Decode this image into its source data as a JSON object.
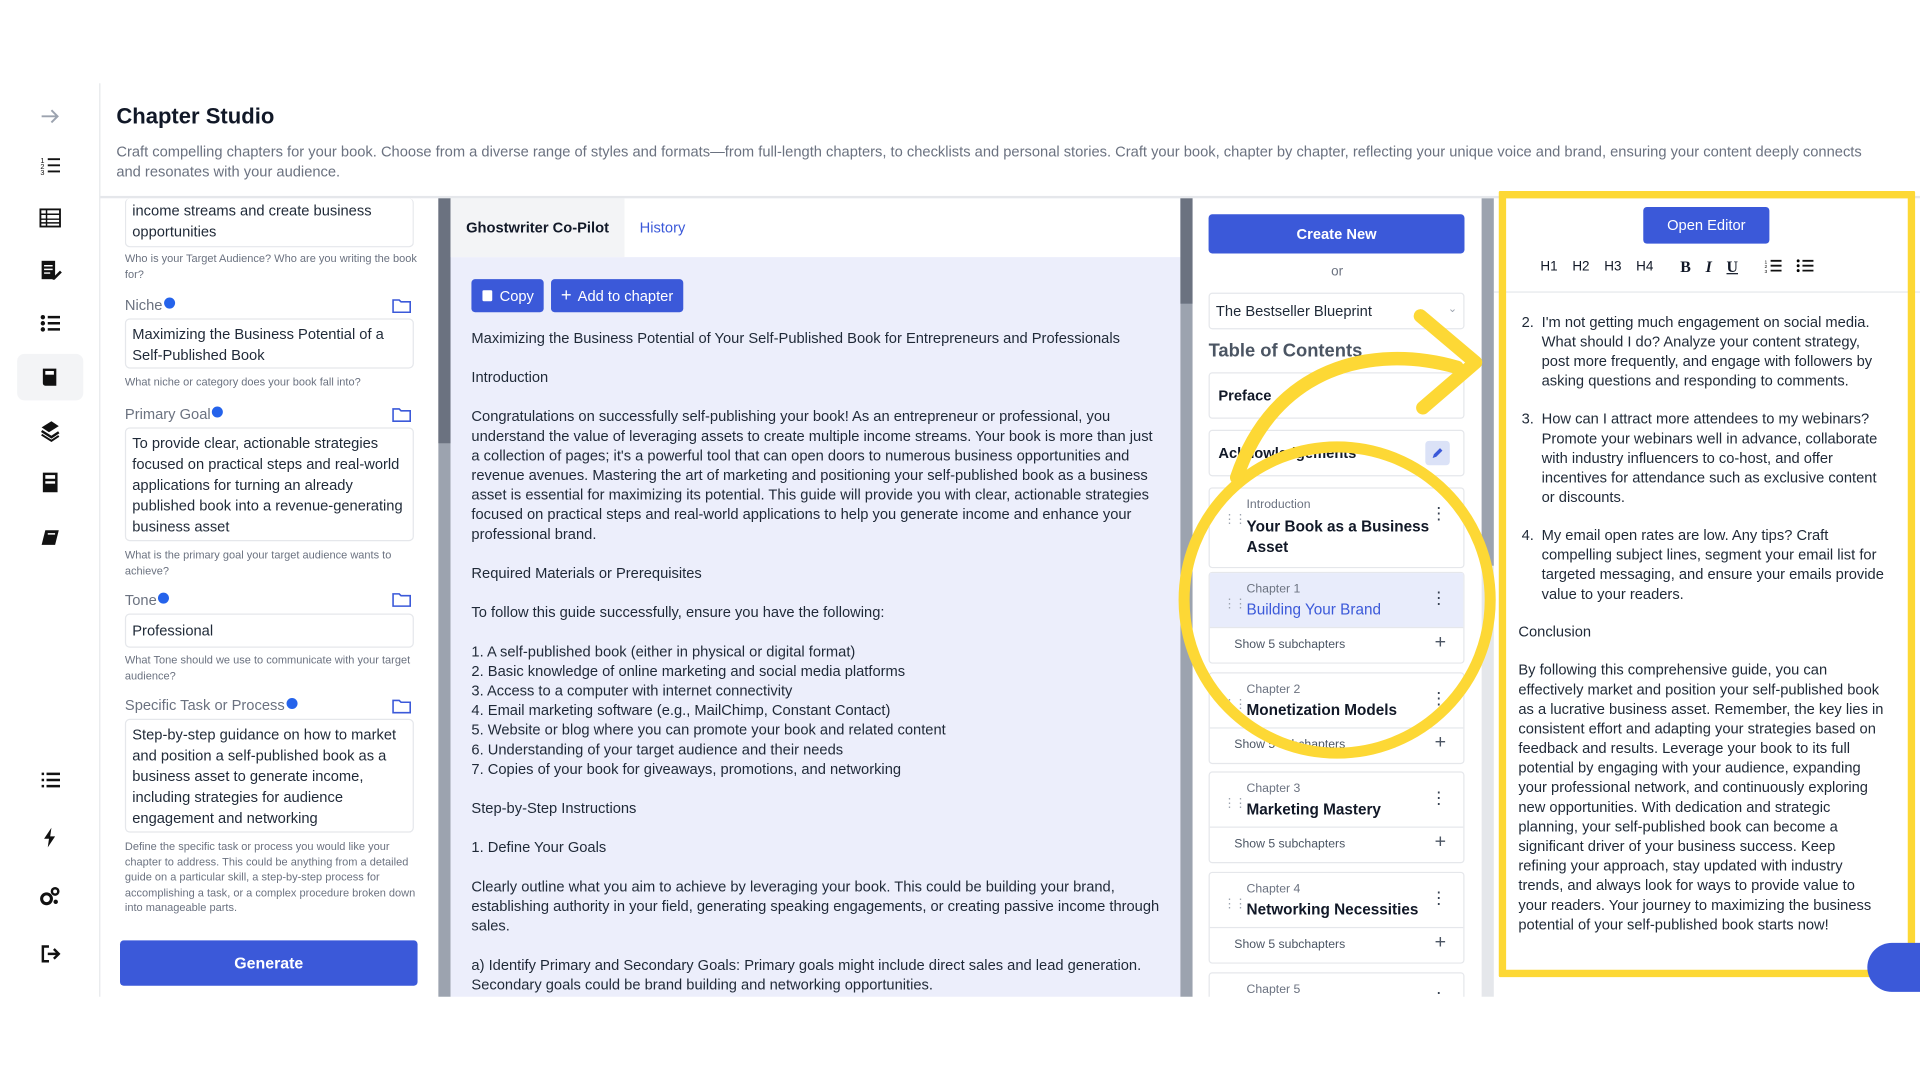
{
  "header": {
    "title": "Chapter Studio",
    "description": "Craft compelling chapters for your book. Choose from a diverse range of styles and formats—from full-length chapters, to checklists and personal stories. Craft your book, chapter by chapter, reflecting your unique voice and brand, ensuring your content deeply connects and resonates with your audience."
  },
  "sidebar": {
    "icons": [
      "arrow-right-icon",
      "numbered-list-icon",
      "table-icon",
      "document-edit-icon",
      "list-icon",
      "book-icon",
      "books-stack-icon",
      "archive-icon",
      "notebook-icon",
      "menu-list-icon",
      "bolt-icon",
      "settings-gears-icon",
      "logout-icon"
    ]
  },
  "form": {
    "audience_value": "income streams and create business opportunities",
    "audience_hint": "Who is your Target Audience? Who are you writing the book for?",
    "niche_label": "Niche",
    "niche_value": "Maximizing the Business Potential of a Self-Published Book",
    "niche_hint": "What niche or category does your book fall into?",
    "goal_label": "Primary Goal",
    "goal_value": "To provide clear, actionable strategies focused on practical steps and real-world applications for turning an already published book into a revenue-generating business asset",
    "goal_hint": "What is the primary goal your target audience wants to achieve?",
    "tone_label": "Tone",
    "tone_value": "Professional",
    "tone_hint": "What Tone should we use to communicate with your target audience?",
    "task_label": "Specific Task or Process",
    "task_value": "Step-by-step guidance on how to market and position a self-published book as a business asset to generate income, including strategies for audience engagement and networking",
    "task_hint": "Define the specific task or process you would like your chapter to address. This could be anything from a detailed guide on a particular skill, a step-by-step process for accomplishing a task, or a complex procedure broken down into manageable parts.",
    "generate_label": "Generate"
  },
  "copilot": {
    "tab_active": "Ghostwriter Co-Pilot",
    "tab_history": "History",
    "copy_label": "Copy",
    "add_label": "Add to chapter",
    "paragraphs": [
      "Maximizing the Business Potential of Your Self-Published Book for Entrepreneurs and Professionals",
      "Introduction",
      "Congratulations on successfully self-publishing your book! As an entrepreneur or professional, you understand the value of leveraging assets to create multiple income streams. Your book is more than just a collection of pages; it's a powerful tool that can open doors to numerous business opportunities and revenue avenues. Mastering the art of marketing and positioning your self-published book as a business asset is essential for maximizing its potential. This guide will provide you with clear, actionable strategies focused on practical steps and real-world applications to help you generate income and enhance your professional brand.",
      "Required Materials or Prerequisites",
      "To follow this guide successfully, ensure you have the following:",
      "1. A self-published book (either in physical or digital format)\n2. Basic knowledge of online marketing and social media platforms\n3. Access to a computer with internet connectivity\n4. Email marketing software (e.g., MailChimp, Constant Contact)\n5. Website or blog where you can promote your book and related content\n6. Understanding of your target audience and their needs\n7. Copies of your book for giveaways, promotions, and networking",
      "Step-by-Step Instructions",
      "1. Define Your Goals",
      "Clearly outline what you aim to achieve by leveraging your book. This could be building your brand, establishing authority in your field, generating speaking engagements, or creating passive income through sales.",
      "a) Identify Primary and Secondary Goals: Primary goals might include direct sales and lead generation. Secondary goals could be brand building and networking opportunities."
    ]
  },
  "toc": {
    "create_new": "Create New",
    "or": "or",
    "blueprint": "The Bestseller Blueprint",
    "title": "Table of Contents",
    "preface": "Preface",
    "acknowledgements": "Acknowledgements",
    "chapters": [
      {
        "num": "Introduction",
        "title": "Your Book as a Business Asset",
        "sub": ""
      },
      {
        "num": "Chapter 1",
        "title": "Building Your Brand",
        "sub": "Show 5 subchapters"
      },
      {
        "num": "Chapter 2",
        "title": "Monetization Models",
        "sub": "Show 5 subchapters"
      },
      {
        "num": "Chapter 3",
        "title": "Marketing Mastery",
        "sub": "Show 5 subchapters"
      },
      {
        "num": "Chapter 4",
        "title": "Networking Necessities",
        "sub": "Show 5 subchapters"
      },
      {
        "num": "Chapter 5",
        "title": "",
        "sub": ""
      }
    ]
  },
  "editor": {
    "open_editor": "Open Editor",
    "toolbar": [
      "H1",
      "H2",
      "H3",
      "H4",
      "B",
      "I",
      "U"
    ],
    "items": [
      "I'm not getting much engagement on social media. What should I do? Analyze your content strategy, post more frequently, and engage with followers by asking questions and responding to comments.",
      "How can I attract more attendees to my webinars? Promote your webinars well in advance, collaborate with industry influencers to co-host, and offer incentives for attendance such as exclusive content or discounts.",
      "My email open rates are low. Any tips? Craft compelling subject lines, segment your email list for targeted messaging, and ensure your emails provide value to your readers."
    ],
    "conclusion_heading": "Conclusion",
    "conclusion": "By following this comprehensive guide, you can effectively market and position your self-published book as a lucrative business asset. Remember, the key lies in consistent effort and adapting your strategies based on feedback and results. Leverage your book to its full potential by engaging with your audience, expanding your professional network, and continuously exploring new opportunities. With dedication and strategic planning, your self-published book can become a significant driver of your business success. Keep refining your approach, stay updated with industry trends, and always look for ways to provide value to your readers. Your journey to maximizing the business potential of your self-published book starts now!"
  },
  "colors": {
    "accent": "#3b59d9",
    "highlight": "#fdd835",
    "panel_bg": "#eceefb"
  }
}
